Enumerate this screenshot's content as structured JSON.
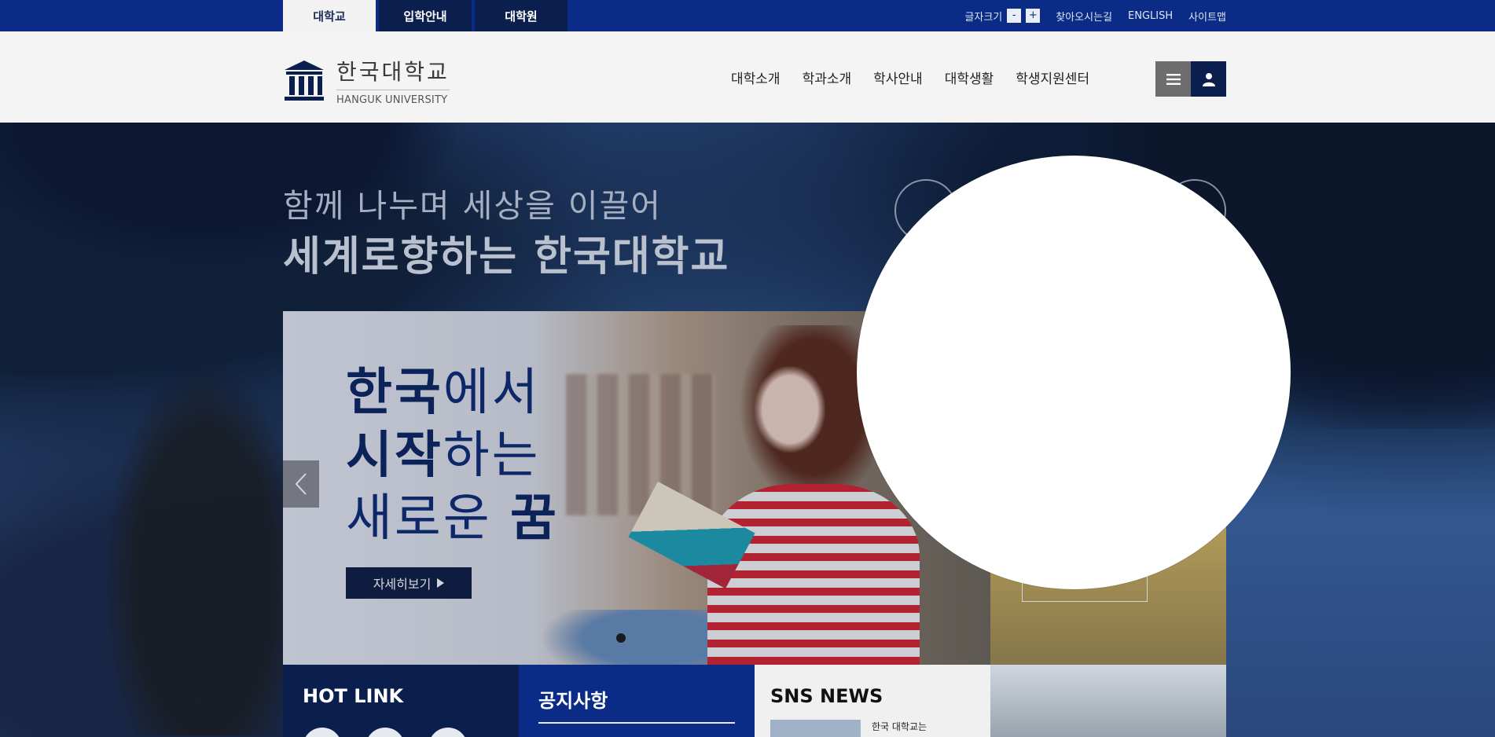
{
  "topbar": {
    "tabs": [
      {
        "label": "대학교"
      },
      {
        "label": "입학안내"
      },
      {
        "label": "대학원"
      }
    ],
    "fontsize_label": "글자크기",
    "fontsize_minus": "-",
    "fontsize_plus": "+",
    "directions": "찾아오시는길",
    "english": "ENGLISH",
    "sitemap": "사이트맵"
  },
  "header": {
    "logo_ko": "한국대학교",
    "logo_en": "HANGUK UNIVERSITY",
    "nav": [
      "대학소개",
      "학과소개",
      "학사안내",
      "대학생활",
      "학생지원센터"
    ],
    "menu_icon": "hamburger-icon",
    "user_icon": "user-icon"
  },
  "hero": {
    "line1": "함께 나누며 세상을 이끌어",
    "line2": "세계로향하는 한국대학교",
    "slide": {
      "l1_bold": "한국",
      "l1_rest": "에서",
      "l2_bold": "시작",
      "l2_rest": "하는",
      "l3_rest": "새로운 ",
      "l3_bold": "꿈",
      "more": "자세히보기"
    }
  },
  "boxes": {
    "hot": "HOT LINK",
    "notice": "공지사항",
    "sns": "SNS NEWS",
    "sns_snippet": "한국 대학교는"
  },
  "colors": {
    "primary": "#0a2c87",
    "navy": "#0b1f4e",
    "header_bg": "#f4f4f4"
  }
}
